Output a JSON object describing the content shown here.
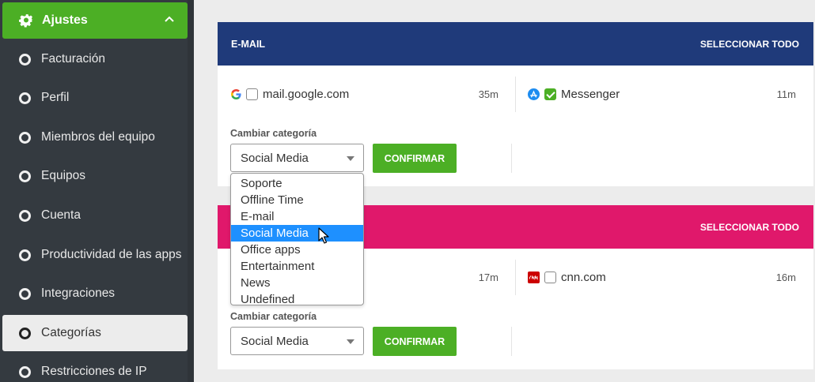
{
  "sidebar": {
    "header": "Ajustes",
    "items": [
      {
        "label": "Facturación"
      },
      {
        "label": "Perfil"
      },
      {
        "label": "Miembros del equipo"
      },
      {
        "label": "Equipos"
      },
      {
        "label": "Cuenta"
      },
      {
        "label": "Productividad de las apps"
      },
      {
        "label": "Integraciones"
      },
      {
        "label": "Categorías",
        "active": true
      },
      {
        "label": "Restricciones de IP"
      }
    ]
  },
  "card1": {
    "title": "E-MAIL",
    "select_all": "SELECCIONAR TODO",
    "color": "#1f3a7a",
    "apps": [
      {
        "name": "mail.google.com",
        "time": "35m",
        "checked": false,
        "icon": "google-icon"
      },
      {
        "name": "Messenger",
        "time": "11m",
        "checked": true,
        "icon": "app-store-icon"
      }
    ],
    "change_label": "Cambiar categoría",
    "select_value": "Social Media",
    "confirm": "CONFIRMAR"
  },
  "card2": {
    "title": "",
    "select_all": "SELECCIONAR TODO",
    "color": "#e0186b",
    "apps": [
      {
        "name": "",
        "time": "17m"
      },
      {
        "name": "cnn.com",
        "time": "16m",
        "checked": false,
        "icon": "cnn-icon"
      }
    ],
    "change_label": "Cambiar categoría",
    "select_value": "Social Media",
    "confirm": "CONFIRMAR"
  },
  "dropdown": {
    "options": [
      "Soporte",
      "Offline Time",
      "E-mail",
      "Social Media",
      "Office apps",
      "Entertainment",
      "News",
      "Undefined"
    ],
    "highlighted": "Social Media",
    "highlight_color": "#1e90ff"
  },
  "colors": {
    "accent": "#4caf25",
    "sidebar_bg": "#343a40"
  }
}
